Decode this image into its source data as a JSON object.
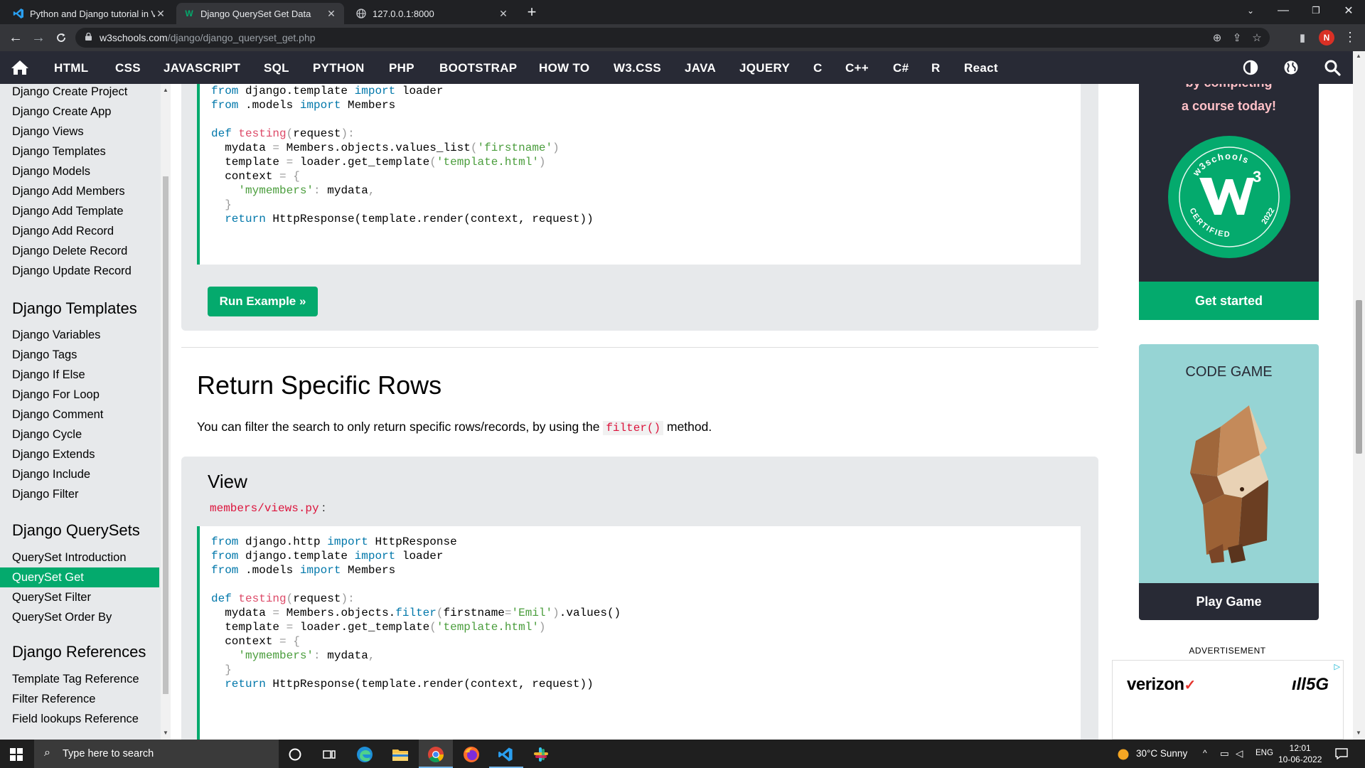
{
  "browser": {
    "tabs": [
      {
        "title": "Python and Django tutorial in Vi",
        "icon": "vscode-icon"
      },
      {
        "title": "Django QuerySet Get Data",
        "icon": "w3schools-icon"
      },
      {
        "title": "127.0.0.1:8000",
        "icon": "globe-icon"
      }
    ],
    "url_host": "w3schools.com",
    "url_path": "/django/django_queryset_get.php",
    "profile_initial": "N"
  },
  "topnav": {
    "links": [
      "HTML",
      "CSS",
      "JAVASCRIPT",
      "SQL",
      "PYTHON",
      "PHP",
      "BOOTSTRAP",
      "HOW TO",
      "W3.CSS",
      "JAVA",
      "JQUERY",
      "C",
      "C++",
      "C#",
      "R",
      "React"
    ]
  },
  "sidebar": {
    "items_top": [
      "Django Create Project",
      "Django Create App",
      "Django Views",
      "Django Templates",
      "Django Models",
      "Django Add Members",
      "Django Add Template",
      "Django Add Record",
      "Django Delete Record",
      "Django Update Record"
    ],
    "section_templates": "Django Templates",
    "items_templates": [
      "Django Variables",
      "Django Tags",
      "Django If Else",
      "Django For Loop",
      "Django Comment",
      "Django Cycle",
      "Django Extends",
      "Django Include",
      "Django Filter"
    ],
    "section_querysets": "Django QuerySets",
    "items_querysets": [
      "QuerySet Introduction",
      "QuerySet Get",
      "QuerySet Filter",
      "QuerySet Order By"
    ],
    "active_item": "QuerySet Get",
    "section_references": "Django References",
    "items_references": [
      "Template Tag Reference",
      "Filter Reference",
      "Field lookups Reference"
    ]
  },
  "main": {
    "example1_code": {
      "l1_from": "from",
      "l1_mod": " django.template ",
      "l1_imp": "import",
      "l1_name": " loader",
      "l2_from": "from",
      "l2_mod": " .models ",
      "l2_imp": "import",
      "l2_name": " Members",
      "def_kw": "def",
      "func_name": "testing",
      "param": "request",
      "mydata_line": "Members.objects.values_list",
      "mydata_arg": "'firstname'",
      "template_line": "loader.get_template",
      "template_arg": "'template.html'",
      "context_kw": "context",
      "mymembers_key": "'mymembers'",
      "mydata_val": "mydata",
      "return_kw": "return",
      "return_expr": "HttpResponse(template.render(context, request))"
    },
    "run_example_label": "Run Example »",
    "section_title": "Return Specific Rows",
    "section_text_before": "You can filter the search to only return specific rows/records, by using the ",
    "section_code": "filter()",
    "section_text_after": " method.",
    "view_title": "View",
    "view_filename": "members/views.py",
    "view_colon": ":",
    "example2_code": {
      "l1_from": "from",
      "l1_mod": " django.http ",
      "l1_imp": "import",
      "l1_name": " HttpResponse",
      "l2_from": "from",
      "l2_mod": " django.template ",
      "l2_imp": "import",
      "l2_name": " loader",
      "l3_from": "from",
      "l3_mod": " .models ",
      "l3_imp": "import",
      "l3_name": " Members",
      "def_kw": "def",
      "func_name": "testing",
      "param": "request",
      "mydata_obj": "Members.objects.",
      "filter_fn": "filter",
      "filter_kw": "firstname",
      "filter_val": "'Emil'",
      "values_fn": ".values()",
      "template_line": "loader.get_template",
      "template_arg": "'template.html'",
      "context_kw": "context",
      "mymembers_key": "'mymembers'",
      "mydata_val": "mydata",
      "return_kw": "return",
      "return_expr": "HttpResponse(template.render(context, request))"
    }
  },
  "ads": {
    "promo_line1": "by completing",
    "promo_line2": "a course today!",
    "badge_top": "w3schools",
    "badge_bottom": "CERTIFIED",
    "badge_year": "2022",
    "get_started_label": "Get started",
    "code_game_title": "CODE GAME",
    "play_game_label": "Play Game",
    "advertisement_label": "ADVERTISEMENT",
    "verizon_text": "verizon",
    "fiveg_text": "5G",
    "colors": {
      "green": "#04aa6d",
      "dark": "#282a35",
      "teal": "#96d4d4"
    }
  },
  "taskbar": {
    "search_placeholder": "Type here to search",
    "weather": "30°C  Sunny",
    "language": "ENG",
    "time": "12:01",
    "date": "10-06-2022"
  }
}
